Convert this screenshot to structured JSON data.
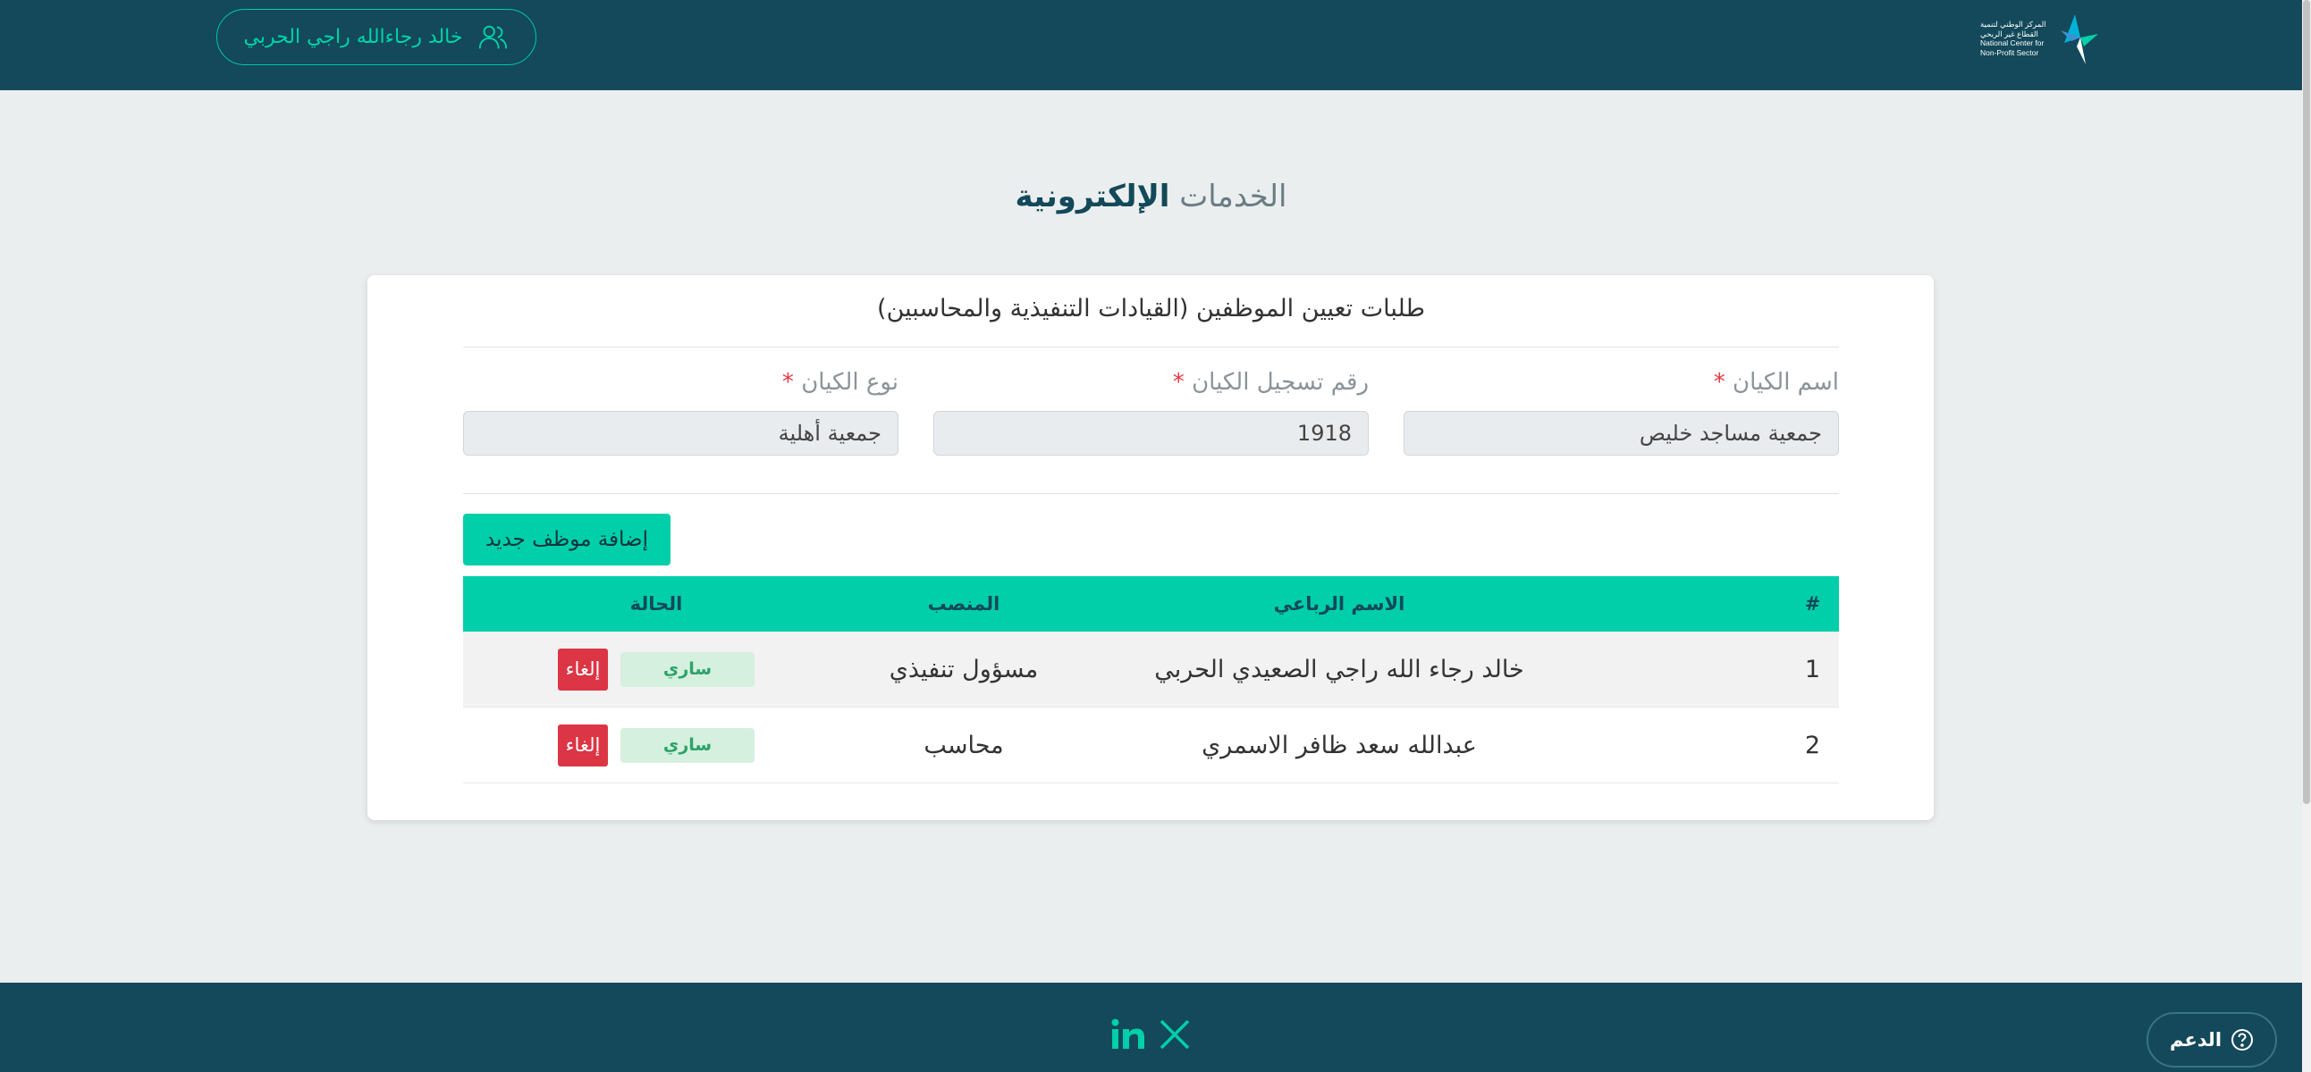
{
  "header": {
    "logo_text_ar_1": "المركز الوطني لتنمية",
    "logo_text_ar_2": "القطاع غير الربحي",
    "logo_text_en_1": "National Center for",
    "logo_text_en_2": "Non-Profit Sector",
    "user_name": "خالد رجاءالله راجي الحربي",
    "user_icon": "users-icon"
  },
  "page": {
    "title_light": "الخدمات",
    "title_bold": "الإلكترونية"
  },
  "card": {
    "title": "طلبات تعيين الموظفين (القيادات التنفيذية والمحاسبين)",
    "fields": {
      "entity_name": {
        "label": "اسم الكيان",
        "required_mark": "*",
        "value": "جمعية مساجد خليص"
      },
      "registration_number": {
        "label": "رقم تسجيل الكيان",
        "required_mark": "*",
        "value": "1918"
      },
      "entity_type": {
        "label": "نوع الكيان",
        "required_mark": "*",
        "value": "جمعية أهلية"
      }
    },
    "add_button": "إضافة موظف جديد",
    "table": {
      "headers": {
        "num": "#",
        "name": "الاسم الرباعي",
        "position": "المنصب",
        "status": "الحالة"
      },
      "rows": [
        {
          "num": "1",
          "name": "خالد رجاء الله راجي الصعيدي الحربي",
          "position": "مسؤول تنفيذي",
          "status": "ساري",
          "action": "إلغاء"
        },
        {
          "num": "2",
          "name": "عبدالله سعد ظافر الاسمري",
          "position": "محاسب",
          "status": "ساري",
          "action": "إلغاء"
        }
      ]
    }
  },
  "footer": {
    "social_icons": [
      "linkedin-icon",
      "x-icon"
    ]
  },
  "support": {
    "label": "الدعم",
    "icon": "help-circle-icon"
  },
  "colors": {
    "header_bg": "#13495a",
    "accent": "#00cfa9",
    "danger": "#dc3545",
    "status_bg": "#d5f0de",
    "status_text": "#2ba36a"
  }
}
